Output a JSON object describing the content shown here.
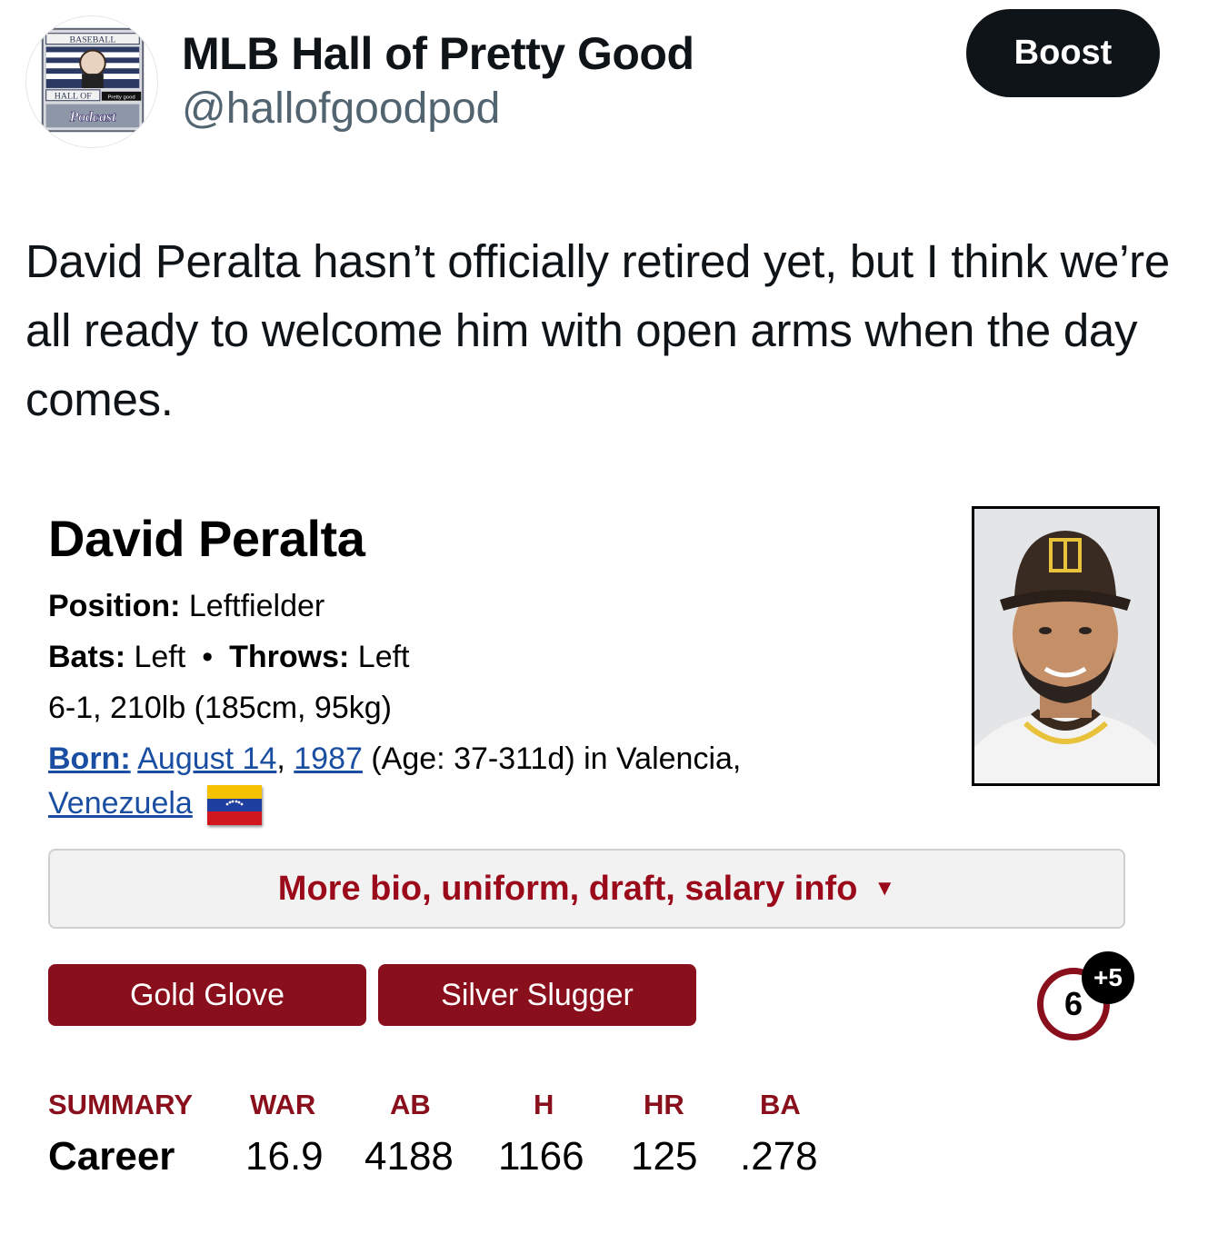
{
  "tweet": {
    "display_name": "MLB Hall of Pretty Good",
    "handle": "@hallofgoodpod",
    "avatar": {
      "text_top": "BASEBALL",
      "text_hall": "HALL OF",
      "text_pretty": "Pretty good",
      "text_podcast": "Podcast"
    },
    "boost_label": "Boost",
    "text": "David Peralta hasn’t officially retired yet, but I think we’re all ready to welcome him with open arms when the day comes."
  },
  "card": {
    "name": "David Peralta",
    "position_label": "Position:",
    "position_value": "Leftfielder",
    "bats_label": "Bats:",
    "bats_value": "Left",
    "separator": "•",
    "throws_label": "Throws:",
    "throws_value": "Left",
    "size": "6-1, 210lb (185cm, 95kg)",
    "born_label": "Born:",
    "born_date": "August 14",
    "born_comma": ",",
    "born_year": "1987",
    "born_rest": "(Age: 37-311d) in Valencia,",
    "born_country": "Venezuela",
    "more_bar_label": "More bio, uniform, draft, salary info",
    "more_bar_arrow": "▼",
    "awards": [
      "Gold Glove",
      "Silver Slugger"
    ],
    "extra_awards_count": "6",
    "extra_awards_plus": "+5",
    "stats": {
      "headers": [
        "SUMMARY",
        "WAR",
        "AB",
        "H",
        "HR",
        "BA"
      ],
      "row_label": "Career",
      "values": [
        "16.9",
        "4188",
        "1166",
        "125",
        ".278"
      ]
    },
    "colors": {
      "award_red": "#8a0f1c",
      "link_blue": "#1a4ea2",
      "more_text_red": "#9b0a1a"
    }
  }
}
